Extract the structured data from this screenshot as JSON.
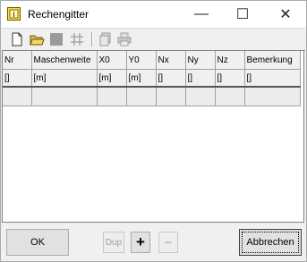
{
  "window": {
    "title": "Rechengitter"
  },
  "titlebar": {
    "minimize_glyph": "—",
    "maximize_glyph": "☐",
    "close_glyph": "✕"
  },
  "toolbar": {
    "icons": [
      "new-document-icon",
      "open-folder-icon",
      "save-icon",
      "grid-icon",
      "copy-icon",
      "print-icon"
    ]
  },
  "table": {
    "columns": [
      "Nr",
      "Maschenweite",
      "X0",
      "Y0",
      "Nx",
      "Ny",
      "Nz",
      "Bemerkung"
    ],
    "units": [
      "[]",
      "[m]",
      "[m]",
      "[m]",
      "[]",
      "[]",
      "[]",
      "[]"
    ],
    "rows": [
      [
        "",
        "",
        "",
        "",
        "",
        "",
        "",
        ""
      ]
    ]
  },
  "buttons": {
    "ok": "OK",
    "dup": "Dup",
    "plus": "+",
    "minus": "−",
    "cancel": "Abbrechen"
  },
  "colors": {
    "window_bg": "#f0f0f0",
    "grid_line": "#a0a0a0",
    "icon_yellow": "#f5d84a"
  }
}
